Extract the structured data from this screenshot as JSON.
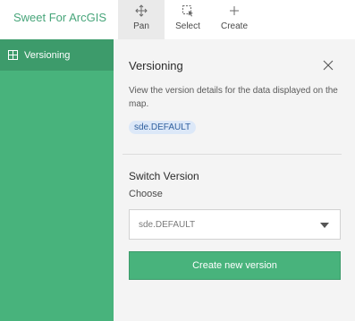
{
  "app": {
    "title": "Sweet For ArcGIS"
  },
  "toolbar": {
    "tools": [
      {
        "label": "Pan",
        "icon": "pan-icon",
        "active": true
      },
      {
        "label": "Select",
        "icon": "select-icon",
        "active": false
      },
      {
        "label": "Create",
        "icon": "plus-icon",
        "active": false
      }
    ]
  },
  "sidebar": {
    "items": [
      {
        "label": "Versioning",
        "icon": "grid-icon",
        "selected": true
      }
    ]
  },
  "panel": {
    "title": "Versioning",
    "description": "View the version details for the data displayed on the map.",
    "current_version": "sde.DEFAULT",
    "switch_title": "Switch Version",
    "choose_label": "Choose",
    "select_value": "sde.DEFAULT",
    "create_button": "Create new version"
  },
  "colors": {
    "brand_green": "#48b37c",
    "brand_green_dark": "#3d9b6b",
    "chip_bg": "#dce8f8",
    "chip_text": "#2f5f9e",
    "panel_bg": "#f4f4f4"
  }
}
